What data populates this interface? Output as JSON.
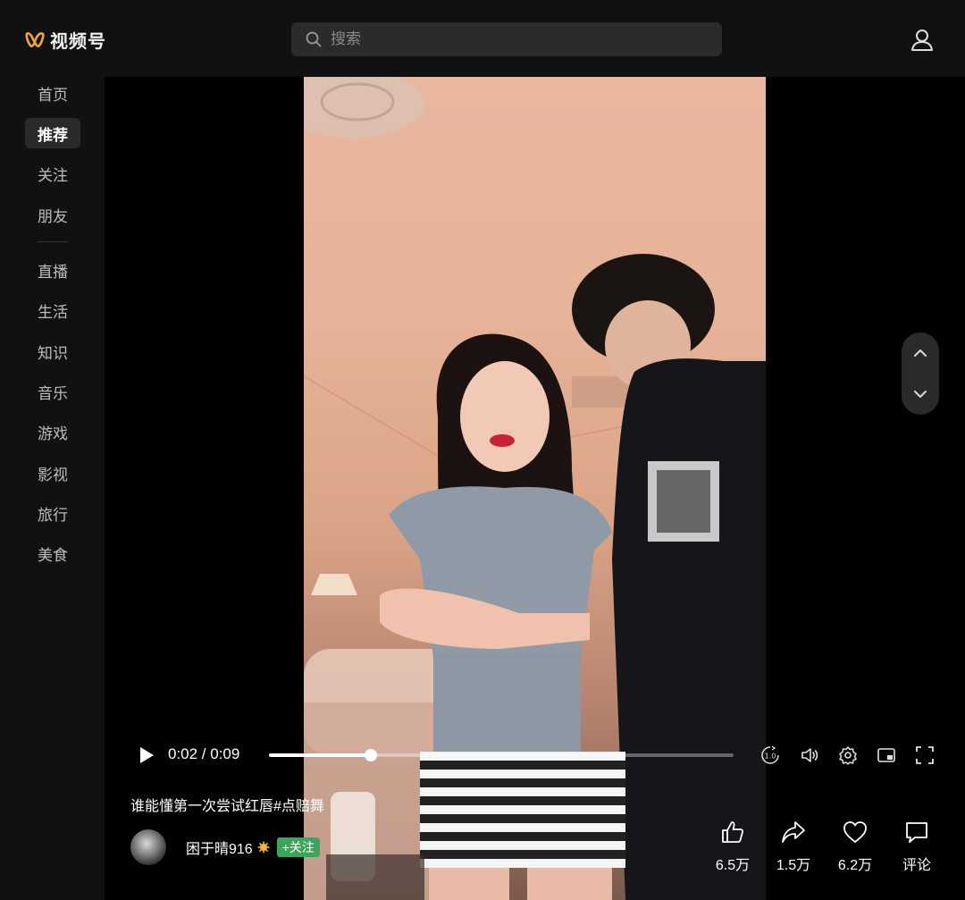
{
  "app": {
    "title": "视频号",
    "brand_color": "#f0a43a"
  },
  "search": {
    "placeholder": "搜索"
  },
  "sidebar": {
    "items": [
      {
        "label": "首页",
        "active": false
      },
      {
        "label": "推荐",
        "active": true
      },
      {
        "label": "关注",
        "active": false
      },
      {
        "label": "朋友",
        "active": false
      },
      {
        "label": "直播",
        "active": false
      },
      {
        "label": "生活",
        "active": false
      },
      {
        "label": "知识",
        "active": false
      },
      {
        "label": "音乐",
        "active": false
      },
      {
        "label": "游戏",
        "active": false
      },
      {
        "label": "影视",
        "active": false
      },
      {
        "label": "旅行",
        "active": false
      },
      {
        "label": "美食",
        "active": false
      }
    ]
  },
  "player": {
    "time": "0:02 / 0:09",
    "progress": 0.22,
    "speed_icon_label": "1.0",
    "caption": "谁能懂第一次尝试红唇#点赔舞",
    "author": {
      "name": "困于晴916",
      "follow_label": "+关注",
      "follow_color": "#3ba55c"
    },
    "actions": {
      "like": "6.5万",
      "share": "1.5万",
      "favorite": "6.2万",
      "comment": "评论"
    }
  }
}
